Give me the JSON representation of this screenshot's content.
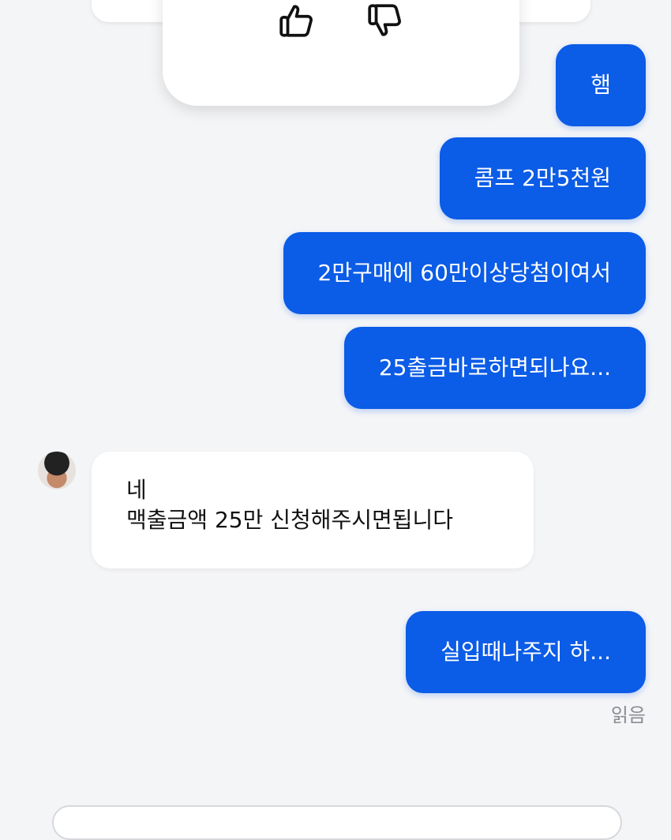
{
  "feedback": {
    "thumbs_up_icon": "thumbs-up-outline",
    "thumbs_down_icon": "thumbs-down-outline"
  },
  "messages": {
    "out": [
      "햄",
      "콤프 2만5천원",
      "2만구매에 60만이상당첨이여서",
      "25출금바로하면되나요...",
      "실입때나주지 하..."
    ],
    "in": {
      "lines": [
        "네",
        "맥출금액 25만 신청해주시면됩니다"
      ]
    }
  },
  "read_status": "읽음",
  "colors": {
    "outgoing_bubble": "#0b5ce6",
    "background": "#f4f5f7",
    "incoming_bubble": "#ffffff"
  }
}
